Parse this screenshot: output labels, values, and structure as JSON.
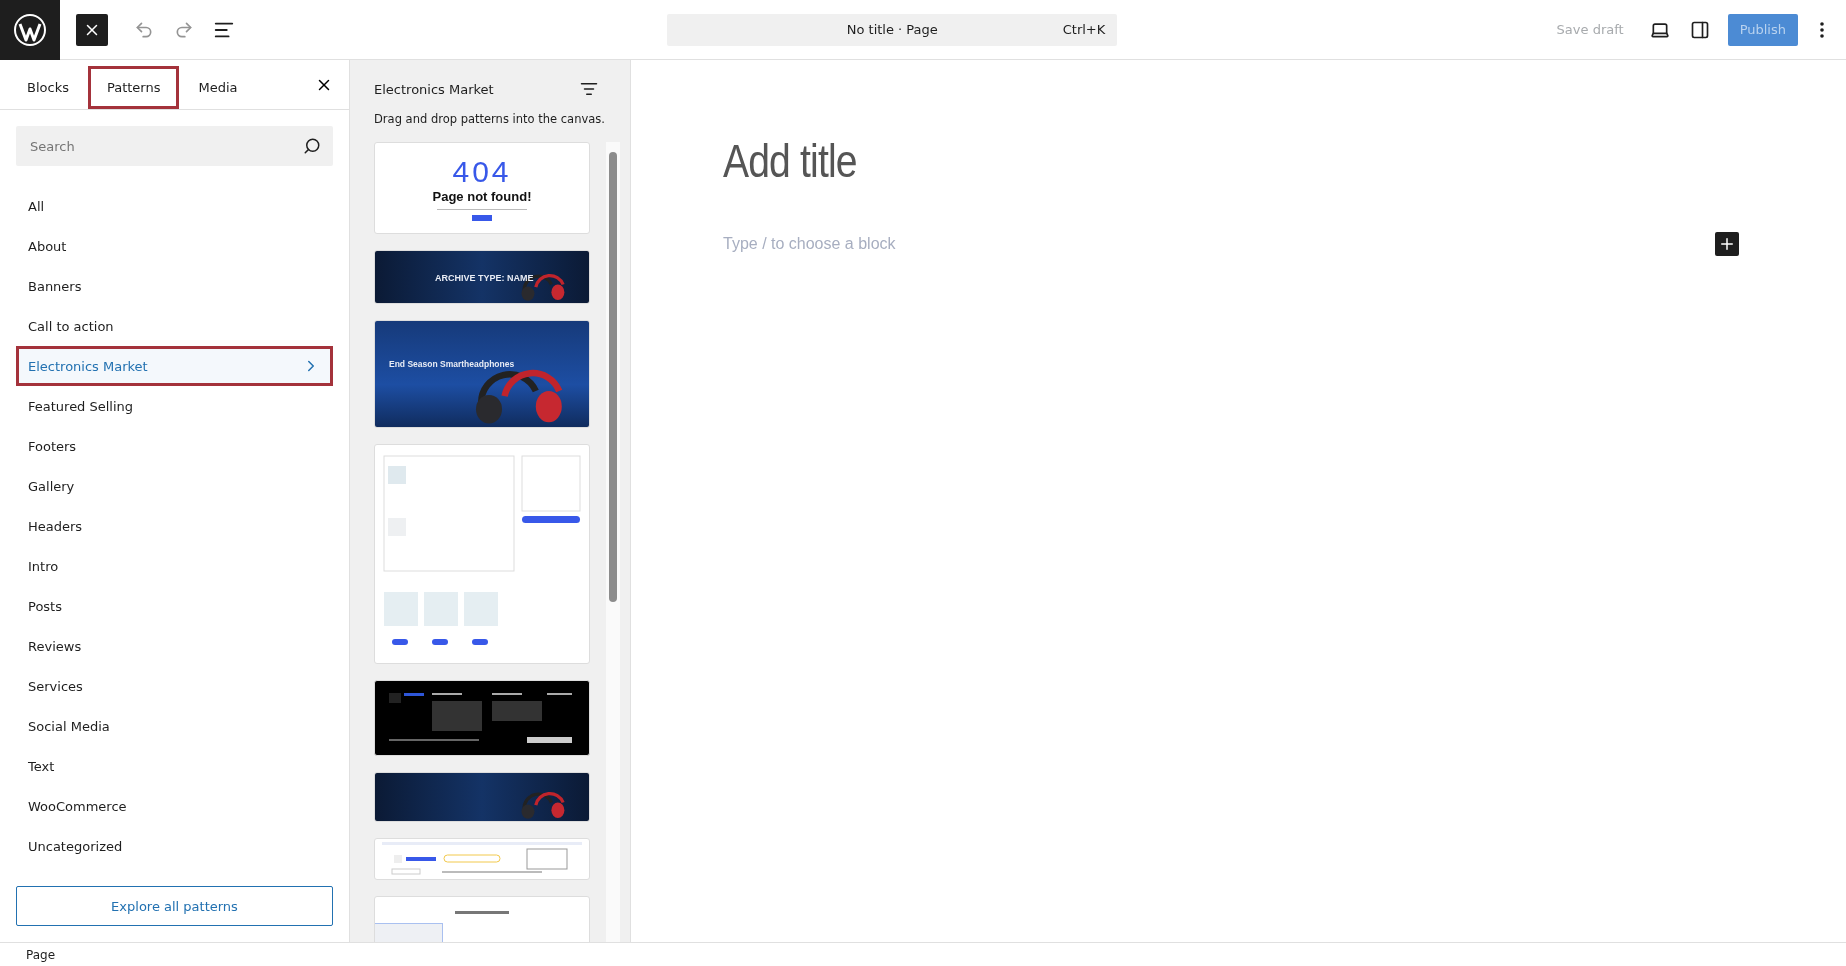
{
  "toolbar": {
    "command_title": "No title · Page",
    "shortcut": "Ctrl+K",
    "save_label": "Save draft",
    "publish_label": "Publish"
  },
  "inserter": {
    "tabs": [
      {
        "label": "Blocks",
        "selected": false
      },
      {
        "label": "Patterns",
        "selected": true
      },
      {
        "label": "Media",
        "selected": false
      }
    ],
    "search": {
      "placeholder": "Search"
    },
    "categories": [
      {
        "label": "All",
        "selected": false
      },
      {
        "label": "About",
        "selected": false
      },
      {
        "label": "Banners",
        "selected": false
      },
      {
        "label": "Call to action",
        "selected": false
      },
      {
        "label": "Electronics Market",
        "selected": true
      },
      {
        "label": "Featured Selling",
        "selected": false
      },
      {
        "label": "Footers",
        "selected": false
      },
      {
        "label": "Gallery",
        "selected": false
      },
      {
        "label": "Headers",
        "selected": false
      },
      {
        "label": "Intro",
        "selected": false
      },
      {
        "label": "Posts",
        "selected": false
      },
      {
        "label": "Reviews",
        "selected": false
      },
      {
        "label": "Services",
        "selected": false
      },
      {
        "label": "Social Media",
        "selected": false
      },
      {
        "label": "Text",
        "selected": false
      },
      {
        "label": "WooCommerce",
        "selected": false
      },
      {
        "label": "Uncategorized",
        "selected": false
      }
    ],
    "explore_label": "Explore all patterns"
  },
  "patterns": {
    "title": "Electronics Market",
    "description": "Drag and drop patterns into the canvas.",
    "items": [
      {
        "kind": "notfound",
        "heading": "404",
        "subheading": "Page not found!"
      },
      {
        "kind": "banner",
        "heading": "ARCHIVE TYPE: NAME"
      },
      {
        "kind": "hero",
        "heading": "End Season Smartheadphones"
      },
      {
        "kind": "cart"
      },
      {
        "kind": "footer"
      },
      {
        "kind": "banner"
      },
      {
        "kind": "header"
      },
      {
        "kind": "posts"
      }
    ]
  },
  "editor": {
    "title_placeholder": "Add title",
    "block_placeholder": "Type / to choose a block"
  },
  "status_bar": {
    "breadcrumb": "Page"
  }
}
